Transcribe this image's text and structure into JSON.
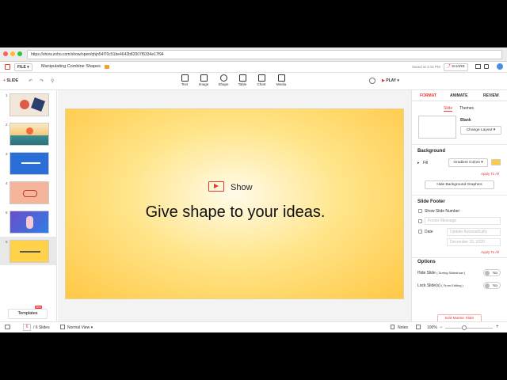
{
  "browser": {
    "url": "https://show.zoho.com/show/open/qhjn54f70c51be4642b82007f6334e17f94"
  },
  "menubar": {
    "file_label": "FILE",
    "doc_title": "Manipulating Combine Shapes",
    "saved": "Saved at 3:16 PM",
    "share": "SHARE"
  },
  "toolbar": {
    "add_slide": "SLIDE",
    "text": "Text",
    "image": "Image",
    "shape": "Shape",
    "table": "Table",
    "chart": "Chart",
    "media": "Media",
    "play": "PLAY"
  },
  "slides": [
    {
      "n": "1"
    },
    {
      "n": "2"
    },
    {
      "n": "3"
    },
    {
      "n": "4"
    },
    {
      "n": "5"
    },
    {
      "n": "6"
    }
  ],
  "slide": {
    "brand": "Show",
    "headline": "Give shape to your ideas."
  },
  "panel": {
    "tabs": [
      "FORMAT",
      "ANIMATE",
      "REVIEW"
    ],
    "subtabs": [
      "Slide",
      "Themes"
    ],
    "layout_name": "Blank",
    "change_layout": "Change Layout",
    "background_title": "Background",
    "fill_label": "Fill",
    "fill_value": "Gradient Colors",
    "apply_all": "Apply To All",
    "hide_bg": "Hide Background Graphics",
    "footer_title": "Slide Footer",
    "show_number": "Show Slide Number",
    "footer_message": "Footer Message",
    "date_label": "Date",
    "date_mode": "Update Automatically",
    "date_value": "December 15, 2020",
    "options_title": "Options",
    "hide_slide": "Hide Slide",
    "hide_slide_note": "( During Slideshow )",
    "lock_slide": "Lock Slide(s)",
    "lock_slide_note": "( From Editing )",
    "toggle_no": "No",
    "master": "Edit Master Slide"
  },
  "status": {
    "templates": "Templates",
    "badge": "New",
    "page": "6",
    "total": "/ 6 Slides",
    "view": "Normal View",
    "notes": "Notes",
    "zoom": "100%"
  },
  "colors": {
    "accent": "#e53935",
    "slide_bg": "#ffd24a"
  }
}
